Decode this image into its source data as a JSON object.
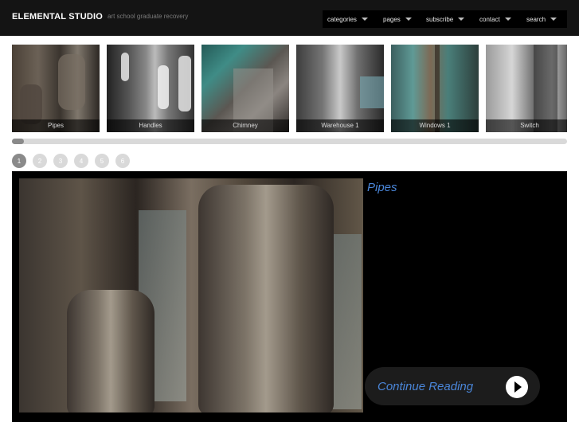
{
  "header": {
    "brand": "ELEMENTAL STUDIO",
    "tagline": "art school graduate recovery",
    "nav": [
      {
        "label": "categories",
        "icon": "chevron-down-icon"
      },
      {
        "label": "pages",
        "icon": "chevron-down-icon"
      },
      {
        "label": "subscribe",
        "icon": "chevron-down-icon"
      },
      {
        "label": "contact",
        "icon": "chevron-down-icon"
      },
      {
        "label": "search",
        "icon": "chevron-down-icon"
      }
    ]
  },
  "thumbnails": [
    {
      "caption": "Pipes"
    },
    {
      "caption": "Handles"
    },
    {
      "caption": "Chimney"
    },
    {
      "caption": "Warehouse 1"
    },
    {
      "caption": "Windows 1"
    },
    {
      "caption": "Switch"
    }
  ],
  "scrollbar": {
    "position_fraction": 0.0
  },
  "pager": {
    "pages": [
      "1",
      "2",
      "3",
      "4",
      "5",
      "6"
    ],
    "active": "1"
  },
  "feature": {
    "title": "Pipes",
    "continue_label": "Continue Reading",
    "continue_icon": "play-icon"
  },
  "colors": {
    "header_bg": "#141414",
    "accent_link": "#4a86d9",
    "feature_bg": "#000000"
  }
}
